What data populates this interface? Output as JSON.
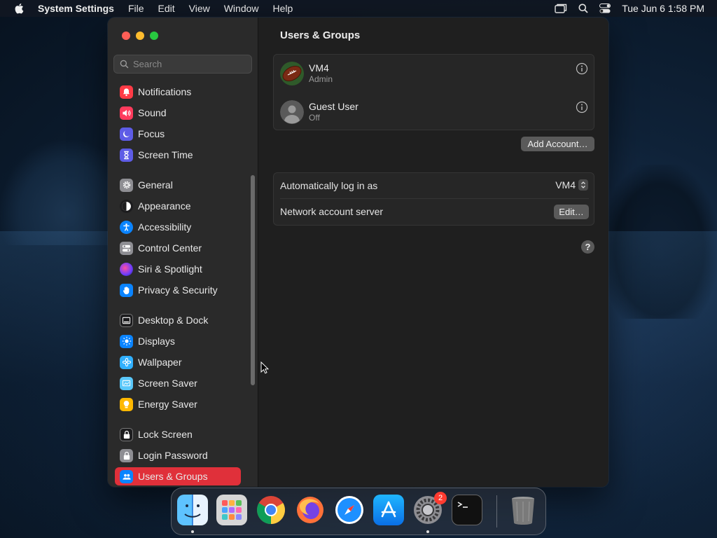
{
  "menubar": {
    "app_name": "System Settings",
    "menus": [
      "File",
      "Edit",
      "View",
      "Window",
      "Help"
    ],
    "clock": "Tue Jun 6  1:58 PM"
  },
  "sidebar": {
    "search_placeholder": "Search",
    "items": [
      {
        "label": "Notifications",
        "icon": "bell-icon",
        "color": "#ff3b46"
      },
      {
        "label": "Sound",
        "icon": "speaker-icon",
        "color": "#ff3b5c"
      },
      {
        "label": "Focus",
        "icon": "moon-icon",
        "color": "#5e5ce6"
      },
      {
        "label": "Screen Time",
        "icon": "hourglass-icon",
        "color": "#5e5ce6"
      },
      {
        "label": "General",
        "icon": "gear-icon",
        "color": "#8e8e93"
      },
      {
        "label": "Appearance",
        "icon": "appearance-icon",
        "color": "#1c1c1e"
      },
      {
        "label": "Accessibility",
        "icon": "accessibility-icon",
        "color": "#0a84ff"
      },
      {
        "label": "Control Center",
        "icon": "toggles-icon",
        "color": "#8e8e93"
      },
      {
        "label": "Siri & Spotlight",
        "icon": "siri-icon",
        "color": "#b04cff"
      },
      {
        "label": "Privacy & Security",
        "icon": "hand-icon",
        "color": "#0a84ff"
      },
      {
        "label": "Desktop & Dock",
        "icon": "dock-icon",
        "color": "#1c1c1e"
      },
      {
        "label": "Displays",
        "icon": "sun-icon",
        "color": "#0a84ff"
      },
      {
        "label": "Wallpaper",
        "icon": "flower-icon",
        "color": "#30b0ff"
      },
      {
        "label": "Screen Saver",
        "icon": "screen-saver-icon",
        "color": "#5ac8fa"
      },
      {
        "label": "Energy Saver",
        "icon": "bulb-icon",
        "color": "#ffb800"
      },
      {
        "label": "Lock Screen",
        "icon": "lock-icon",
        "color": "#1c1c1e"
      },
      {
        "label": "Login Password",
        "icon": "lock-icon",
        "color": "#8e8e93"
      },
      {
        "label": "Users & Groups",
        "icon": "users-icon",
        "color": "#0a84ff"
      }
    ],
    "selected": "Users & Groups"
  },
  "content": {
    "title": "Users & Groups",
    "users": [
      {
        "name": "VM4",
        "role": "Admin",
        "avatar": "football-avatar"
      },
      {
        "name": "Guest User",
        "role": "Off",
        "avatar": "generic-avatar"
      }
    ],
    "add_account_label": "Add Account…",
    "auto_login": {
      "label": "Automatically log in as",
      "value": "VM4"
    },
    "network_server": {
      "label": "Network account server",
      "button": "Edit…"
    },
    "help_label": "?"
  },
  "dock": {
    "apps": [
      "Finder",
      "Launchpad",
      "Google Chrome",
      "Firefox",
      "Safari",
      "App Store",
      "System Settings",
      "Terminal",
      "Trash"
    ],
    "settings_badge": "2"
  },
  "colors": {
    "accent": "#e0303a",
    "window_bg": "#1f1f1f",
    "sidebar_bg": "#2a2a2a"
  }
}
